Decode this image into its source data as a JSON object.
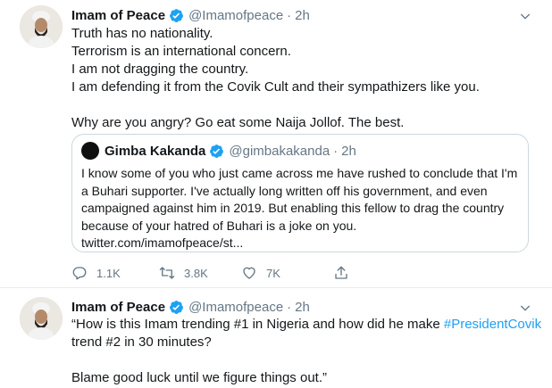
{
  "tweet1": {
    "name": "Imam of Peace",
    "handle": "@Imamofpeace",
    "time": "2h",
    "lines": [
      "Truth has no nationality.",
      "Terrorism is an international concern.",
      "I am not dragging the country.",
      "I am defending it from the Covik Cult and their sympathizers like you."
    ],
    "line_after": "Why are you angry? Go eat some Naija Jollof. The best.",
    "quote": {
      "name": "Gimba Kakanda",
      "handle": "@gimbakakanda",
      "time": "2h",
      "lines": [
        "I know some of you who just came across me have rushed to conclude that I'm",
        "a Buhari supporter. I've actually long written off his government, and even",
        "campaigned against him in 2019. But enabling this  fellow to drag the country",
        "because of your hatred of Buhari is a joke on you.",
        "twitter.com/imamofpeace/st..."
      ]
    },
    "actions": {
      "replies": "1.1K",
      "retweets": "3.8K",
      "likes": "7K"
    }
  },
  "tweet2": {
    "name": "Imam of Peace",
    "handle": "@Imamofpeace",
    "time": "2h",
    "line1": "“How is this Imam trending #1 in Nigeria and how did he make ",
    "hashtag": "#PresidentCovik",
    "line2": " trend #2 in 30 minutes?",
    "line3": "Blame good luck until we figure things out.”"
  },
  "icons": {
    "verified": "verified-badge-icon",
    "caret": "chevron-down-icon",
    "reply": "reply-icon",
    "retweet": "retweet-icon",
    "like": "heart-icon",
    "share": "share-icon"
  },
  "colors": {
    "accent": "#1da1f2",
    "muted": "#657786",
    "text": "#14171a",
    "border": "#ccd6dd"
  },
  "separator": "·"
}
